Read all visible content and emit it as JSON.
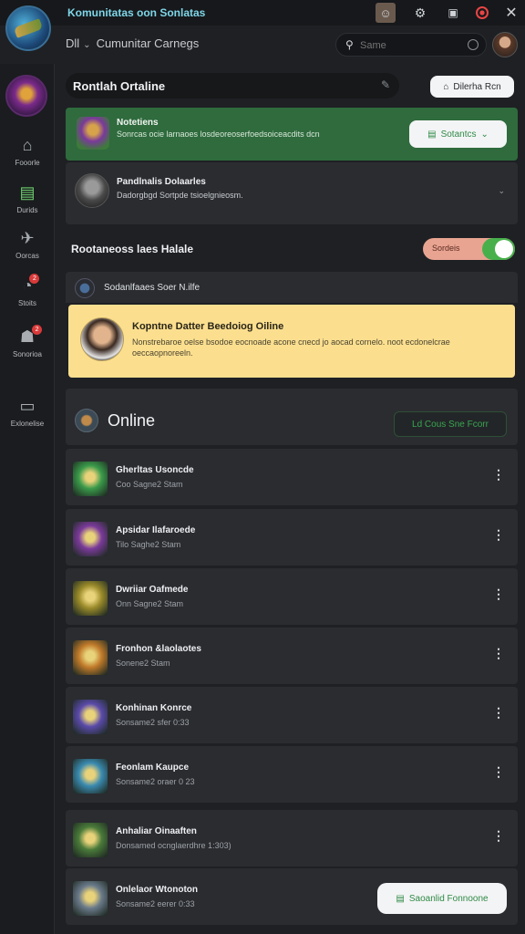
{
  "titlebar": {
    "title": "Komunitatas oon Sonlatas"
  },
  "header": {
    "crumb_left": "Dll",
    "crumb_right": "Cumunitar Carnegs",
    "search_placeholder": "Same"
  },
  "sidebar": {
    "items": [
      {
        "label": "Fooorle",
        "icon": "gamepad-icon"
      },
      {
        "label": "Durids",
        "icon": "message-icon",
        "active": true
      },
      {
        "label": "Oorcas",
        "icon": "rocket-icon"
      },
      {
        "label": "Stoits",
        "icon": "radar-icon",
        "badge": "2"
      },
      {
        "label": "Sonorioa",
        "icon": "users-icon",
        "badge": "2"
      },
      {
        "label": "Exlonelise",
        "icon": "screen-icon"
      }
    ]
  },
  "main": {
    "section_title": "Rontlah Ortaline",
    "top_button": "Dilerha Rcn",
    "notification": {
      "title": "Notetiens",
      "desc": "Sonrcas ocie larnaoes losdeoreoserfoedsoiceacdits dcn",
      "button": "Sotantcs"
    },
    "pending": {
      "title": "Pandlnalis Dolaarles",
      "desc": "Dadorgbgd Sortpde tsioelgnieosm."
    },
    "recommend": {
      "title": "Rootaneoss laes Halale",
      "toggle_label": "Sordeis"
    },
    "now_row": "Sodanlfaaes Soer N.ilfe",
    "feature": {
      "title": "Kopntne Datter Beedoiog Oiline",
      "desc": "Nonstrebaroe oelse bsodoe eocnoade acone cnecd jo aocad cornelo. noot ecdonelcrae oeccaopnoreeln."
    },
    "online": {
      "title": "Online",
      "button": "Ld Cous Sne Fcorr"
    },
    "friends": [
      {
        "name": "Gherltas Usoncde",
        "status": "Coo Sagne2 Stam",
        "thumb": "#3a9a4a"
      },
      {
        "name": "Apsidar Ilafaroede",
        "status": "Tilo Saghe2 Stam",
        "thumb": "#7a3a9a"
      },
      {
        "name": "Dwriiar Oafmede",
        "status": "Onn Sagne2 Stam",
        "thumb": "#9a8a2a"
      },
      {
        "name": "Fronhon &laolaotes",
        "status": "Sonene2 Stam",
        "thumb": "#c07a2a"
      },
      {
        "name": "Konhinan Konrce",
        "status": "Sonsame2 sfer 0:33",
        "thumb": "#5a4aaa"
      },
      {
        "name": "Feonlam Kaupce",
        "status": "Sonsame2 oraer 0 23",
        "thumb": "#3a8ab0"
      },
      {
        "name": "Anhaliar Oinaaften",
        "status": "Donsamed ocnglaerdhre 1:303)",
        "thumb": "#4a7a3a"
      },
      {
        "name": "Onlelaor Wtonoton",
        "status": "Sonsame2 eerer 0:33",
        "thumb": "#6a7a8a"
      }
    ],
    "bottom_button": "Saoanlid Fonnoone"
  }
}
